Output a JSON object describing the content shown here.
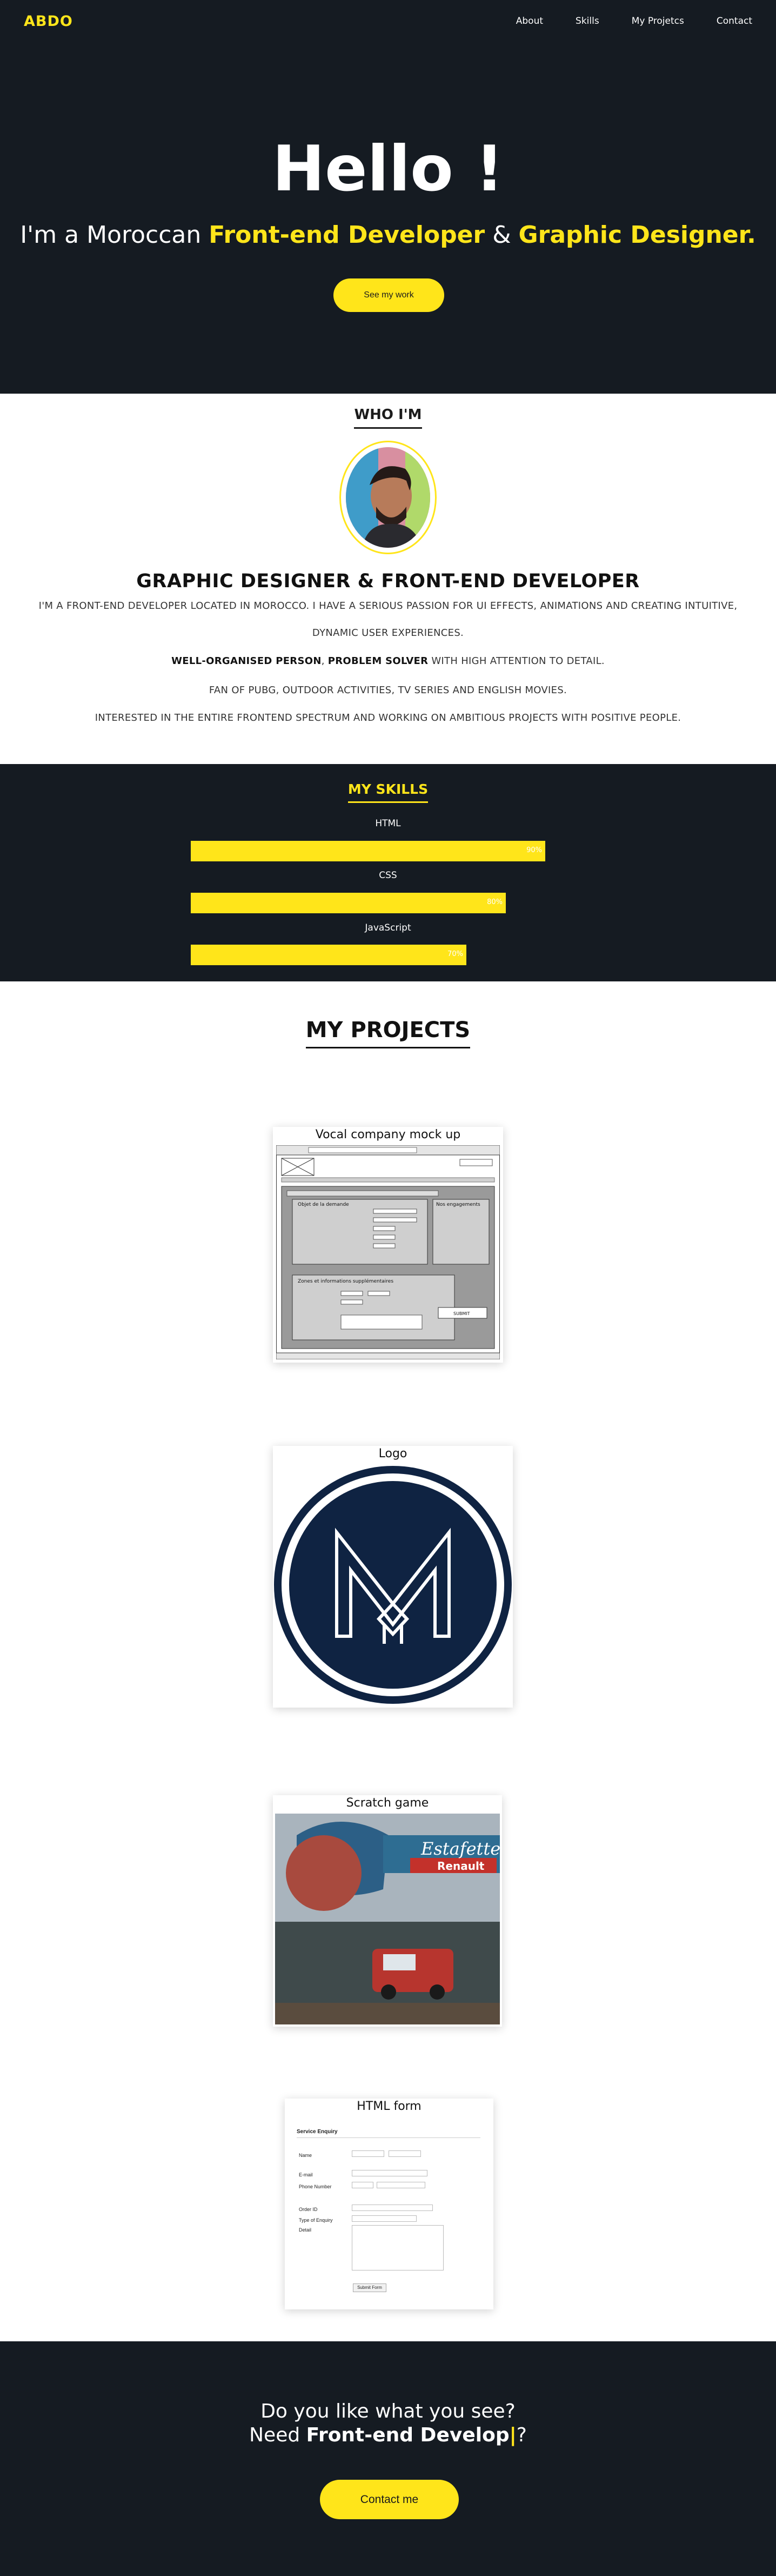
{
  "nav": {
    "brand": "ABDO",
    "links": [
      "About",
      "Skills",
      "My Projetcs",
      "Contact"
    ]
  },
  "hero": {
    "title": "Hello !",
    "sub_prefix": "I'm a Moroccan ",
    "sub_role1": "Front-end Developer",
    "sub_amp": " & ",
    "sub_role2": "Graphic Designer.",
    "button": "See my work"
  },
  "about": {
    "title": "WHO I'M",
    "heading": "GRAPHIC DESIGNER & FRONT-END DEVELOPER",
    "p1": "I'M A FRONT-END DEVELOPER LOCATED IN MOROCCO. I HAVE A SERIOUS PASSION FOR UI EFFECTS, ANIMATIONS AND CREATING INTUITIVE,",
    "p2": "DYNAMIC USER EXPERIENCES.",
    "p3_b1": "WELL-ORGANISED PERSON",
    "p3_sep": ", ",
    "p3_b2": "PROBLEM SOLVER",
    "p3_rest": " WITH HIGH ATTENTION TO DETAIL.",
    "p4": "FAN OF PUBG, OUTDOOR ACTIVITIES, TV SERIES AND ENGLISH MOVIES.",
    "p5": "INTERESTED IN THE ENTIRE FRONTEND SPECTRUM AND WORKING ON AMBITIOUS PROJECTS WITH POSITIVE PEOPLE."
  },
  "skills": {
    "title": "MY SKILLS",
    "items": [
      {
        "name": "HTML",
        "label": "90%",
        "level": 0.9
      },
      {
        "name": "CSS",
        "label": "80%",
        "level": 0.8
      },
      {
        "name": "JavaScript",
        "label": "70%",
        "level": 0.7
      }
    ]
  },
  "projects": {
    "title": "MY PROJECTS",
    "items": [
      {
        "title": "Vocal company mock up"
      },
      {
        "title": "Logo"
      },
      {
        "title": "Scratch game"
      },
      {
        "title": "HTML form"
      }
    ],
    "mockup": {
      "panel_left": "Objet de la demande",
      "panel_right": "Nos engagements",
      "panel_bottom": "Zones et informations supplémentaires",
      "submit": "SUBMIT"
    },
    "scratch": {
      "sign": "Estafette",
      "brand": "Renault"
    },
    "form": {
      "heading": "Service Enquiry",
      "labels": [
        "Name",
        "E-mail",
        "Phone Number",
        "Order ID",
        "Type of Enquiry",
        "Detail"
      ],
      "submit": "Submit Form"
    }
  },
  "footer": {
    "question": "Do you like what you see?",
    "need_prefix": "Need ",
    "need_bold": "Front-end Develop",
    "cursor": "|",
    "need_suffix": "?",
    "button": "Contact me"
  },
  "colors": {
    "dark": "#151b22",
    "accent": "#ffe51a",
    "logo_navy": "#0f2342"
  }
}
